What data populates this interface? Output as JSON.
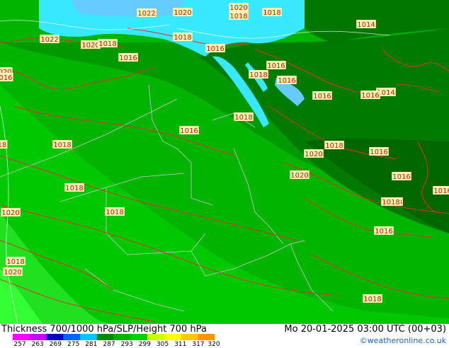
{
  "legend": {
    "title": "Thickness 700/1000 hPa/SLP/Height 700 hPa",
    "ticks": [
      "257",
      "263",
      "269",
      "275",
      "281",
      "287",
      "293",
      "299",
      "305",
      "311",
      "317",
      "320"
    ],
    "colors": [
      "#ff00ff",
      "#c800ff",
      "#0000c8",
      "#0064ff",
      "#00c8ff",
      "#008c00",
      "#00b400",
      "#00d200",
      "#c8ff00",
      "#ffff00",
      "#ffc800",
      "#ff9600"
    ]
  },
  "valid_time": "Mo 20-01-2025 03:00 UTC (00+03)",
  "credit": "©weatheronline.co.uk",
  "colors": {
    "sea_cold": "#38e8ff",
    "sea_mid": "#66ccff",
    "dark_green": "#007800",
    "mid_green": "#009a00",
    "light_green": "#00c000",
    "bright_green": "#33ff33",
    "isobar": "#e03030",
    "border": "#c8c8c8"
  },
  "pressure_labels": [
    "1022",
    "1020",
    "1020",
    "1018",
    "1018",
    "1014",
    "1022",
    "1020",
    "1018",
    "1018",
    "1016",
    "1016",
    "1016",
    "1018",
    "1016",
    "1016",
    "1014",
    "1016",
    "1018",
    "1016",
    "1018",
    "1018",
    "1020",
    "1016",
    "1020",
    "1016",
    "1018",
    "1016",
    "1018",
    "1018",
    "1020",
    "1018",
    "1016",
    "1020",
    "1018",
    "1018",
    "020",
    "016",
    "18"
  ]
}
